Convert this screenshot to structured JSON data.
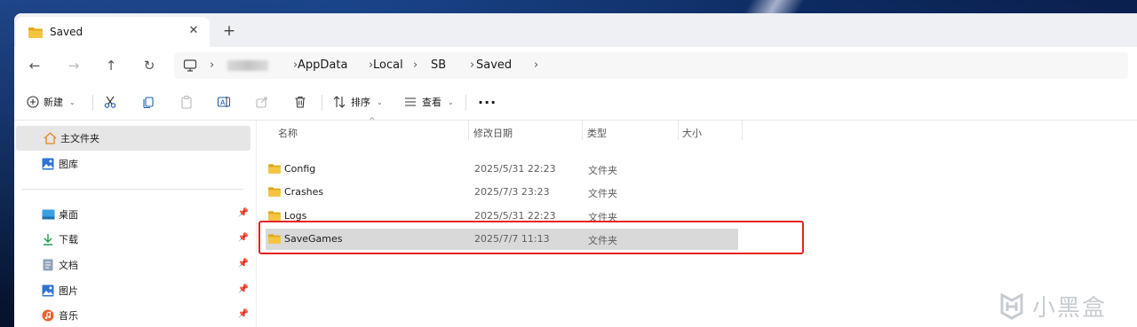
{
  "tab": {
    "title": "Saved",
    "close_glyph": "✕",
    "new_glyph": "+"
  },
  "nav": {
    "back": "←",
    "forward": "→",
    "up": "↑",
    "refresh": "↻"
  },
  "breadcrumb": {
    "separator": "›",
    "items": [
      "AppData",
      "Local",
      "SB",
      "Saved"
    ]
  },
  "commands": {
    "new_label": "新建",
    "sort_label": "排序",
    "view_label": "查看",
    "more_label": "···"
  },
  "sidebar": {
    "home": "主文件夹",
    "gallery": "图库",
    "desktop": "桌面",
    "downloads": "下载",
    "documents": "文档",
    "pictures": "图片",
    "music": "音乐"
  },
  "columns": {
    "name": "名称",
    "date": "修改日期",
    "type": "类型",
    "size": "大小"
  },
  "rows": [
    {
      "name": "Config",
      "date": "2025/5/31 22:23",
      "type": "文件夹"
    },
    {
      "name": "Crashes",
      "date": "2025/7/3 23:23",
      "type": "文件夹"
    },
    {
      "name": "Logs",
      "date": "2025/5/31 22:23",
      "type": "文件夹"
    },
    {
      "name": "SaveGames",
      "date": "2025/7/7 11:13",
      "type": "文件夹"
    }
  ],
  "watermark": "小黑盒",
  "colors": {
    "folder": "#f4c542",
    "folder_dark": "#e0a91b",
    "highlight": "#e62222",
    "selected": "#d9d9d9"
  }
}
